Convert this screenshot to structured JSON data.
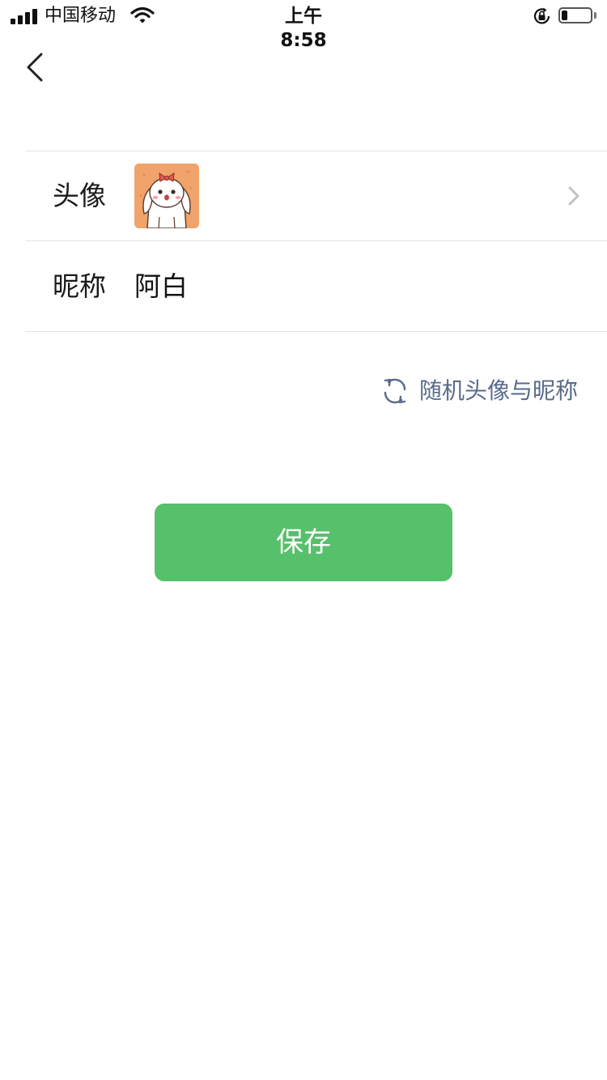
{
  "status_bar": {
    "carrier": "中国移动",
    "time": "上午 8:58",
    "battery_level": 0.2
  },
  "nav": {
    "back_icon": "chevron-left-icon"
  },
  "form": {
    "avatar_label": "头像",
    "avatar_image": "cartoon-dog-avatar",
    "nickname_label": "昵称",
    "nickname_value": "阿白"
  },
  "random_link": {
    "icon": "refresh-icon",
    "label": "随机头像与昵称"
  },
  "save_button": {
    "label": "保存"
  },
  "colors": {
    "save_button": "#57c06a",
    "link_text": "#596a8a",
    "divider": "#e2e2e2",
    "avatar_background": "#f0a36a"
  }
}
